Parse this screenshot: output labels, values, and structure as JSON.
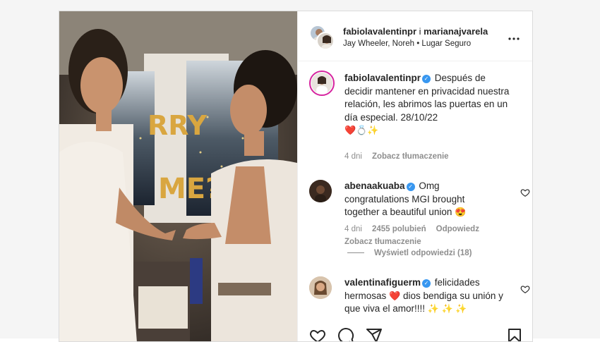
{
  "post": {
    "header": {
      "username_primary": "fabiolavalentinpr",
      "separator": " i ",
      "username_secondary": "marianajvarela",
      "audio": "Jay Wheeler, Noreh",
      "bullet": " • ",
      "track": "Lugar Seguro",
      "more_icon": "more-horizontal-icon"
    },
    "media": {
      "balloon_text_top": "RRY",
      "balloon_text_bottom": "ME?"
    },
    "caption": {
      "username": "fabiolavalentinpr",
      "text": "Después de decidir mantener en privacidad nuestra relación, les abrimos las puertas en un día especial. 28/10/22",
      "emojis": "❤️💍✨",
      "age": "4 dni",
      "translate": "Zobacz tłumaczenie"
    },
    "comments": [
      {
        "username": "abenaakuaba",
        "text": "Omg congratulations MGI brought together a beautiful union",
        "emoji": "😍",
        "age": "4 dni",
        "likes": "2455 polubień",
        "reply": "Odpowiedz",
        "translate": "Zobacz tłumaczenie"
      },
      {
        "username": "valentinafiguerm",
        "text_before": "felicidades hermosas",
        "emoji_mid": "❤️",
        "text_after": "dios bendiga su unión y que viva el amor!!!!",
        "emoji_end": "✨ ✨ ✨"
      }
    ],
    "view_replies": "Wyświetl odpowiedzi (18)",
    "colors": {
      "verified": "#3897f0",
      "muted": "#8e8e8e",
      "text": "#262626",
      "border": "#dbdbdb"
    },
    "action_icons": [
      "heart-icon",
      "comment-icon",
      "share-icon",
      "save-icon"
    ]
  }
}
